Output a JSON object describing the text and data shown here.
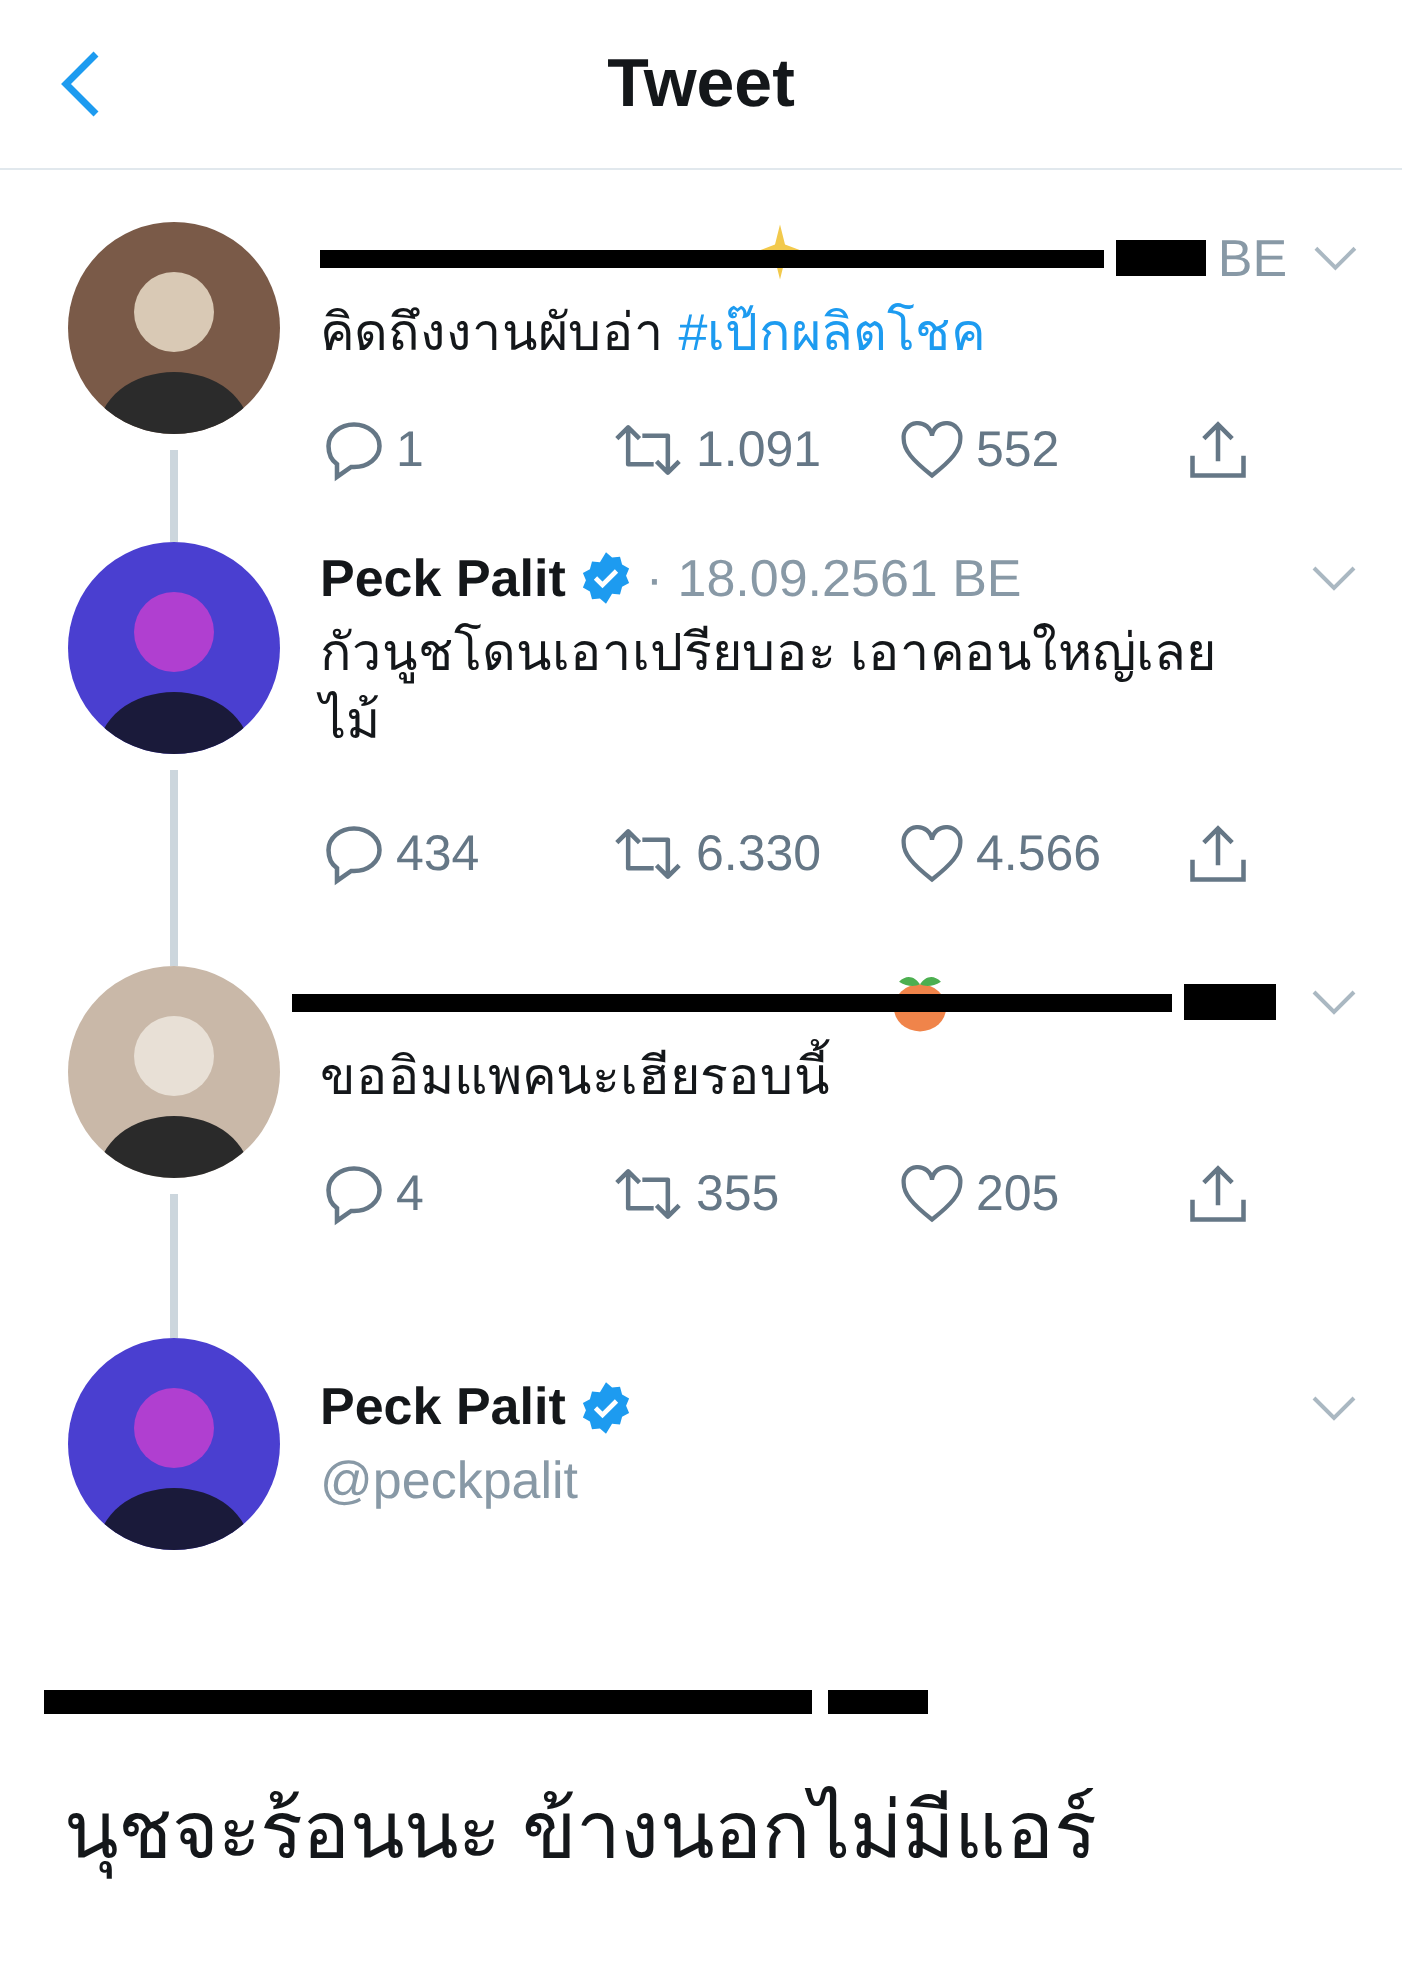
{
  "header": {
    "title": "Tweet"
  },
  "thread": [
    {
      "kind": "redacted",
      "date_tail": "BE",
      "text": "คิดถึงงานผับอ่า",
      "hashtag": "#เป๊กผลิตโชค",
      "replies": "1",
      "retweets": "1.091",
      "likes": "552"
    },
    {
      "kind": "named",
      "name": "Peck Palit",
      "verified": true,
      "date": "· 18.09.2561 BE",
      "text": "กัวนูชโดนเอาเปรียบอะ เอาคอนใหญ่เลยไม้",
      "replies": "434",
      "retweets": "6.330",
      "likes": "4.566"
    },
    {
      "kind": "redacted",
      "text": "ขออิมแพคนะเฮียรอบนี้",
      "replies": "4",
      "retweets": "355",
      "likes": "205"
    }
  ],
  "main_tweet": {
    "name": "Peck Palit",
    "verified": true,
    "handle": "@peckpalit",
    "reply_line_redacted": true,
    "text": "นุชจะร้อนนะ ข้างนอกไม่มีแอร์"
  }
}
